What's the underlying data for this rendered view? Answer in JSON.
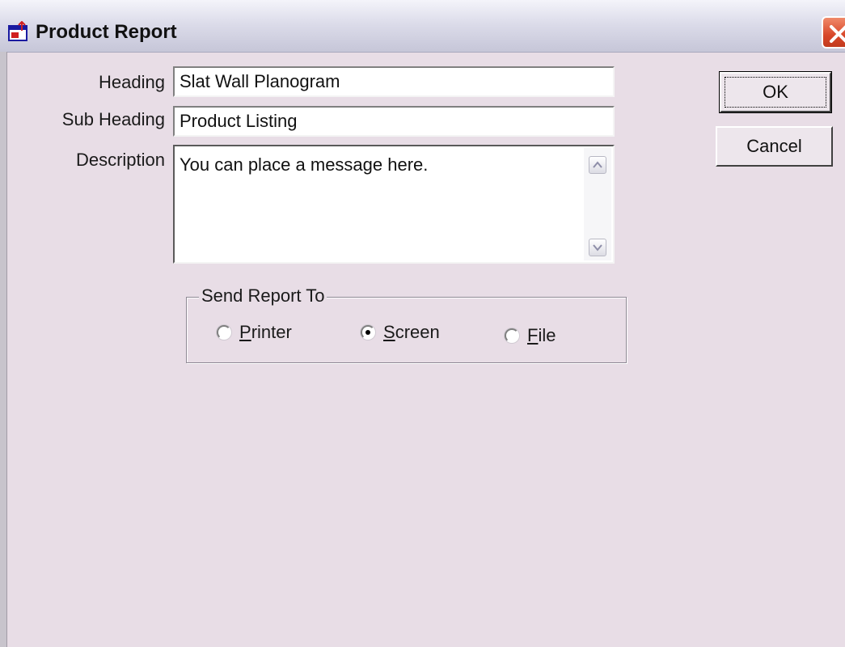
{
  "window": {
    "title": "Product Report"
  },
  "form": {
    "heading": {
      "label": "Heading",
      "value": "Slat Wall Planogram"
    },
    "sub_heading": {
      "label": "Sub Heading",
      "value": "Product Listing"
    },
    "description": {
      "label": "Description",
      "value": "You can place a message here."
    }
  },
  "buttons": {
    "ok": "OK",
    "cancel": "Cancel"
  },
  "send_report_to": {
    "legend": "Send Report To",
    "options": [
      {
        "mnemonic": "P",
        "rest": "rinter",
        "selected": false
      },
      {
        "mnemonic": "S",
        "rest": "creen",
        "selected": true
      },
      {
        "mnemonic": "F",
        "rest": "ile",
        "selected": false
      }
    ]
  },
  "icons": {
    "window": "report-window-icon",
    "close": "close-icon",
    "scroll_up": "scroll-up-arrow-icon",
    "scroll_down": "scroll-down-arrow-icon"
  },
  "colors": {
    "dialog_background": "#e8dde6",
    "close_button": "#d8472a"
  }
}
